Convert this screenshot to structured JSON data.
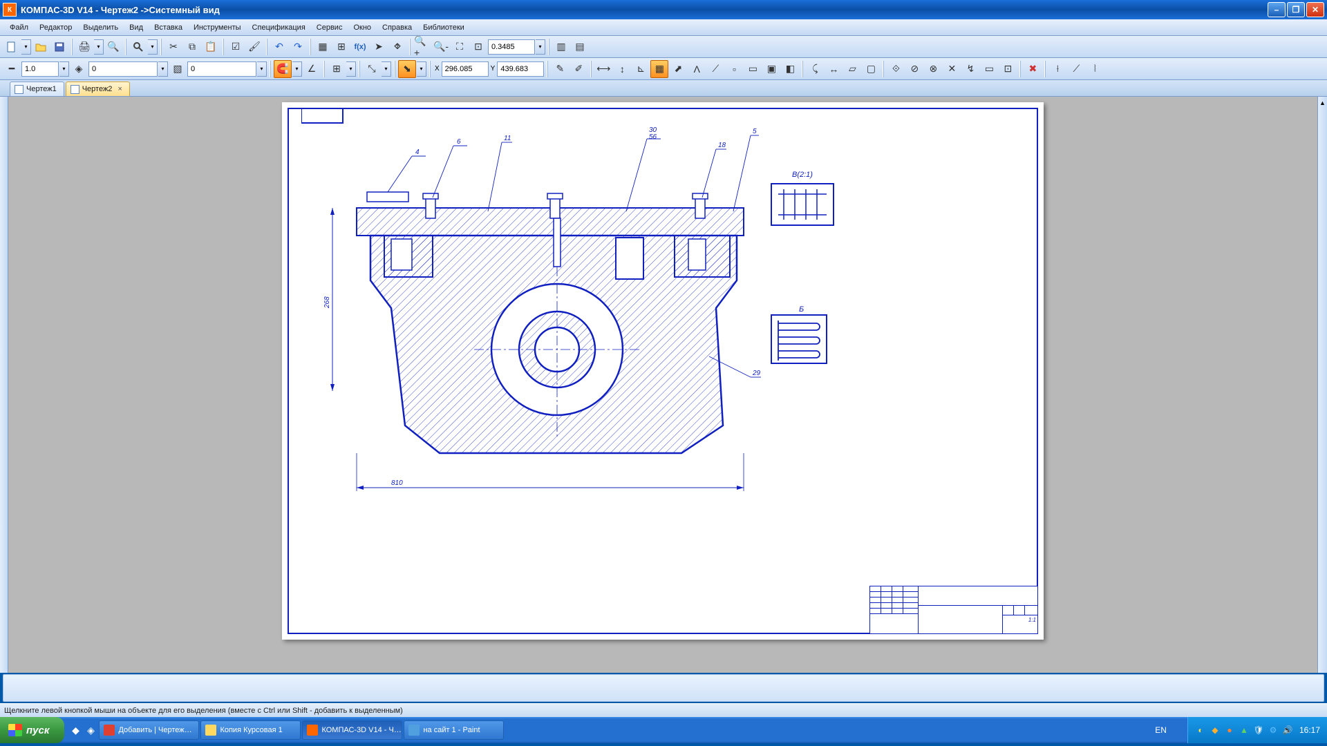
{
  "titlebar": {
    "title": "КОМПАС-3D V14 - Чертеж2 ->Системный вид"
  },
  "menubar": {
    "items": [
      "Файл",
      "Редактор",
      "Выделить",
      "Вид",
      "Вставка",
      "Инструменты",
      "Спецификация",
      "Сервис",
      "Окно",
      "Справка",
      "Библиотеки"
    ]
  },
  "toolbar1": {
    "zoom_value": "0.3485",
    "icons": [
      "new-doc",
      "open",
      "save",
      "print",
      "preview",
      "search",
      "cut",
      "copy",
      "paste",
      "props",
      "brush",
      "undo",
      "redo",
      "layers",
      "grid",
      "fx",
      "cursor",
      "help-cursor",
      "zoom-in",
      "zoom-out",
      "zoom-region",
      "zoom-fit"
    ]
  },
  "toolbar2": {
    "scale_value": "1.0",
    "layer_value": "0",
    "color_value": "0",
    "x_value": "296.085",
    "y_value": "439.683",
    "x_label": "X",
    "y_label": "Y"
  },
  "tabs": [
    {
      "label": "Чертеж1",
      "active": false
    },
    {
      "label": "Чертеж2",
      "active": true
    }
  ],
  "drawing": {
    "callouts": [
      "4",
      "6",
      "11",
      "30",
      "56",
      "18",
      "5",
      "29"
    ],
    "detail_labels": [
      "В(2:1)",
      "Б"
    ],
    "dim_height": "268",
    "dim_width": "810"
  },
  "status": {
    "text": "Щелкните левой кнопкой мыши на объекте для его выделения (вместе с Ctrl или Shift - добавить к выделенным)"
  },
  "taskbar": {
    "start": "пуск",
    "items": [
      {
        "label": "Добавить | Чертеж…",
        "icon_color": "#e04030"
      },
      {
        "label": "Копия Курсовая 1",
        "icon_color": "#ffd860"
      },
      {
        "label": "КОМПАС-3D V14 - Ч…",
        "icon_color": "#ff6600",
        "active": true
      },
      {
        "label": "на сайт 1 - Paint",
        "icon_color": "#50a0e0"
      }
    ],
    "lang": "EN",
    "clock": "16:17"
  }
}
